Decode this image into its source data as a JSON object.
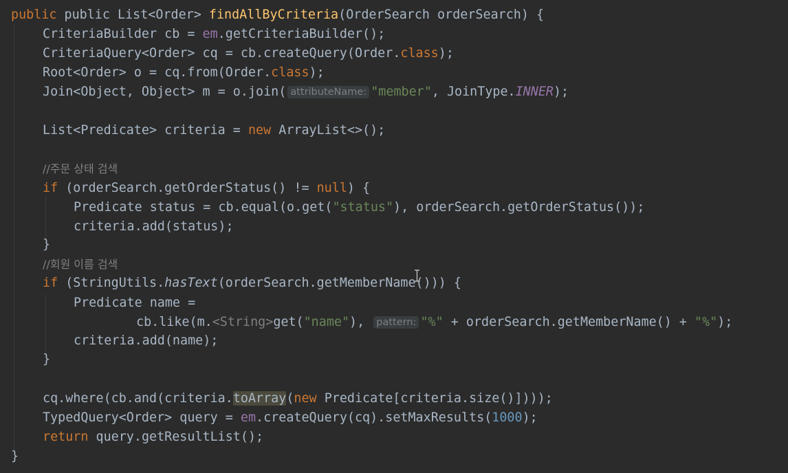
{
  "lines": [
    [
      "public List<Order> ",
      "findAllByCriteria",
      "(OrderSearch orderSearch) {"
    ],
    [
      "CriteriaBuilder cb = ",
      "em",
      ".getCriteriaBuilder();"
    ],
    [
      "CriteriaQuery<Order> cq = cb.createQuery(Order.",
      "class",
      ");"
    ],
    [
      "Root<Order> o = cq.from(Order.",
      "class",
      ");"
    ],
    [
      "Join<Object, Object> m = o.join(",
      "attributeName:",
      "\"member\"",
      ", JoinType.",
      "INNER",
      ");"
    ],
    [],
    [
      "List<Predicate> criteria = ",
      "new",
      " ArrayList<>();"
    ],
    [],
    [
      "//주문 상태 검색"
    ],
    [
      "if",
      " (orderSearch.getOrderStatus() != ",
      "null",
      ") {"
    ],
    [
      "Predicate status = cb.equal(o.get(",
      "\"status\"",
      "), orderSearch.getOrderStatus());"
    ],
    [
      "criteria.add(status);"
    ],
    [
      "}"
    ],
    [
      "//회원 이름 검색"
    ],
    [
      "if",
      " (StringUtils.",
      "hasText",
      "(orderSearch.getMemberName())) {"
    ],
    [
      "Predicate name ="
    ],
    [
      "cb.like(m.",
      "<String>",
      "get(",
      "\"name\"",
      "), ",
      "pattern:",
      "\"%\"",
      " + orderSearch.getMemberName() + ",
      "\"%\"",
      ");"
    ],
    [
      "criteria.add(name);"
    ],
    [
      "}"
    ],
    [],
    [
      "cq.where(cb.and(criteria.",
      "toArray",
      "(",
      "new",
      " Predicate[criteria.size()])));"
    ],
    [
      "TypedQuery<Order> query = ",
      "em",
      ".createQuery(cq).setMaxResults(",
      "1000",
      ");"
    ],
    [
      "return",
      " query.getResultList();"
    ],
    [
      "}"
    ]
  ],
  "colors": {
    "background": "#2b2b2b",
    "text": "#a9b7c6",
    "keyword": "#cc7832",
    "string": "#6a8759",
    "comment": "#808080",
    "method_decl": "#ffc66d",
    "field": "#9876aa",
    "number": "#6897bb"
  }
}
